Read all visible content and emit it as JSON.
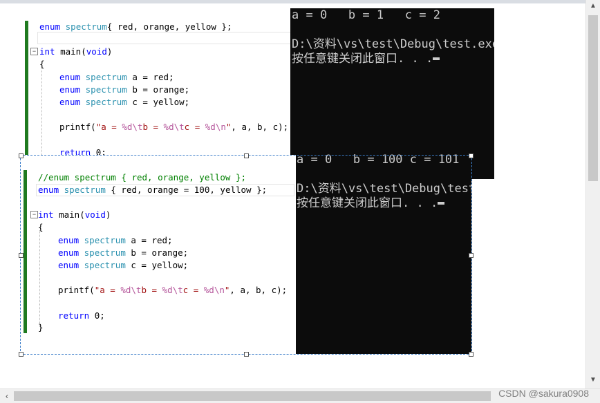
{
  "snippet1": {
    "lines": [
      {
        "id": "l1",
        "tokens": [
          [
            "kw",
            "enum "
          ],
          [
            "ty",
            "spectrum"
          ],
          [
            "",
            "{ red, orange, yellow };"
          ]
        ]
      },
      {
        "id": "l2",
        "tokens": [
          [
            "kw",
            "int "
          ],
          [
            "",
            "main("
          ],
          [
            "kw",
            "void"
          ],
          [
            "",
            ")"
          ]
        ]
      },
      {
        "id": "l3",
        "tokens": [
          [
            "",
            "{"
          ]
        ]
      },
      {
        "id": "l4",
        "tokens": [
          [
            "kw",
            "enum "
          ],
          [
            "ty",
            "spectrum "
          ],
          [
            "",
            "a = red;"
          ]
        ]
      },
      {
        "id": "l5",
        "tokens": [
          [
            "kw",
            "enum "
          ],
          [
            "ty",
            "spectrum "
          ],
          [
            "",
            "b = orange;"
          ]
        ]
      },
      {
        "id": "l6",
        "tokens": [
          [
            "kw",
            "enum "
          ],
          [
            "ty",
            "spectrum "
          ],
          [
            "",
            "c = yellow;"
          ]
        ]
      },
      {
        "id": "l7",
        "tokens": [
          [
            "",
            "printf("
          ],
          [
            "str",
            "\"a = "
          ],
          [
            "esc",
            "%d\\t"
          ],
          [
            "str",
            "b = "
          ],
          [
            "esc",
            "%d\\t"
          ],
          [
            "str",
            "c = "
          ],
          [
            "esc",
            "%d\\n"
          ],
          [
            "str",
            "\""
          ],
          [
            "",
            ", a, b, c);"
          ]
        ]
      },
      {
        "id": "l8",
        "tokens": [
          [
            "kw",
            "return "
          ],
          [
            "",
            "0;"
          ]
        ]
      }
    ]
  },
  "snippet2": {
    "lines": [
      {
        "id": "m1",
        "tokens": [
          [
            "cmt",
            "//enum spectrum { red, orange, yellow };"
          ]
        ]
      },
      {
        "id": "m2",
        "tokens": [
          [
            "kw",
            "enum "
          ],
          [
            "ty",
            "spectrum "
          ],
          [
            "",
            "{ red, orange = 100, yellow };"
          ]
        ]
      },
      {
        "id": "m3",
        "tokens": [
          [
            "kw",
            "int "
          ],
          [
            "",
            "main("
          ],
          [
            "kw",
            "void"
          ],
          [
            "",
            ")"
          ]
        ]
      },
      {
        "id": "m4",
        "tokens": [
          [
            "",
            "{"
          ]
        ]
      },
      {
        "id": "m5",
        "tokens": [
          [
            "kw",
            "enum "
          ],
          [
            "ty",
            "spectrum "
          ],
          [
            "",
            "a = red;"
          ]
        ]
      },
      {
        "id": "m6",
        "tokens": [
          [
            "kw",
            "enum "
          ],
          [
            "ty",
            "spectrum "
          ],
          [
            "",
            "b = orange;"
          ]
        ]
      },
      {
        "id": "m7",
        "tokens": [
          [
            "kw",
            "enum "
          ],
          [
            "ty",
            "spectrum "
          ],
          [
            "",
            "c = yellow;"
          ]
        ]
      },
      {
        "id": "m8",
        "tokens": [
          [
            "",
            "printf("
          ],
          [
            "str",
            "\"a = "
          ],
          [
            "esc",
            "%d\\t"
          ],
          [
            "str",
            "b = "
          ],
          [
            "esc",
            "%d\\t"
          ],
          [
            "str",
            "c = "
          ],
          [
            "esc",
            "%d\\n"
          ],
          [
            "str",
            "\""
          ],
          [
            "",
            ", a, b, c);"
          ]
        ]
      },
      {
        "id": "m9",
        "tokens": [
          [
            "kw",
            "return "
          ],
          [
            "",
            "0;"
          ]
        ]
      },
      {
        "id": "m10",
        "tokens": [
          [
            "",
            "}"
          ]
        ]
      }
    ]
  },
  "console1": {
    "line1": "a = 0   b = 1   c = 2",
    "line2": "",
    "line3": "D:\\资料\\vs\\test\\Debug\\test.exe",
    "line4": "按任意键关闭此窗口. . ."
  },
  "console2": {
    "line1": "a = 0   b = 100 c = 101",
    "line2": "",
    "line3": "D:\\资料\\vs\\test\\Debug\\test.exe",
    "line4": "按任意键关闭此窗口. . ."
  },
  "watermark": "CSDN @sakura0908",
  "colors": {
    "keyword": "#0000ff",
    "type": "#2b91af",
    "string": "#a31515",
    "escape": "#b5569b",
    "comment": "#008000",
    "console_bg": "#0c0c0c",
    "console_fg": "#cccccc",
    "change_bar": "#1f7a1f",
    "selection": "#3a7cc8"
  }
}
